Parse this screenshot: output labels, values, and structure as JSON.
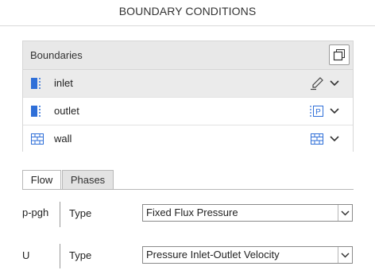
{
  "header": {
    "title": "BOUNDARY CONDITIONS"
  },
  "boundaries_panel": {
    "heading": "Boundaries",
    "copy_icon": "copy-icon",
    "rows": [
      {
        "name": "inlet",
        "left_icon": "patch-icon",
        "right_icon": "pencil-icon",
        "selected": true
      },
      {
        "name": "outlet",
        "left_icon": "patch-icon",
        "right_icon": "pressure-p-icon",
        "right_icon_text": "P",
        "selected": false
      },
      {
        "name": "wall",
        "left_icon": "wall-icon",
        "right_icon": "wall-icon",
        "selected": false
      }
    ]
  },
  "tabs": [
    {
      "label": "Flow",
      "active": true
    },
    {
      "label": "Phases",
      "active": false
    }
  ],
  "fields": [
    {
      "label": "p-pgh",
      "type_label": "Type",
      "value": "Fixed Flux Pressure"
    },
    {
      "label": "U",
      "type_label": "Type",
      "value": "Pressure Inlet-Outlet Velocity"
    }
  ],
  "colors": {
    "accent_blue": "#2f6fd8",
    "selected_row": "#ebebeb",
    "header_bg": "#e8e8e8"
  }
}
